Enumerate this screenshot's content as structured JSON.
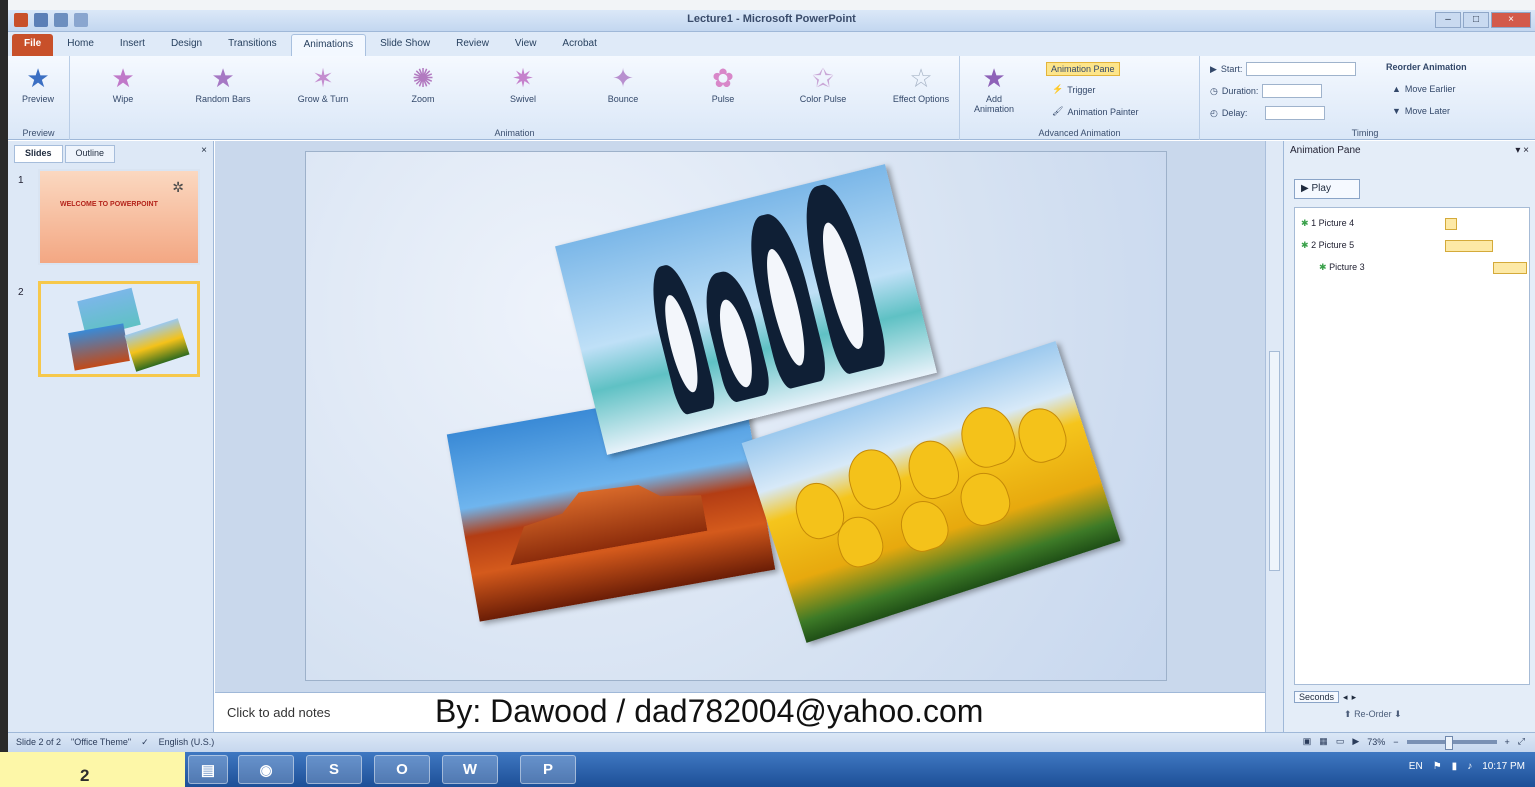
{
  "window": {
    "title": "Lecture1 - Microsoft PowerPoint"
  },
  "tabs": [
    "File",
    "Home",
    "Insert",
    "Design",
    "Transitions",
    "Animations",
    "Slide Show",
    "Review",
    "View",
    "Acrobat"
  ],
  "ribbon": {
    "preview_label": "Preview",
    "preview_group": "Preview",
    "animations": [
      "Wipe",
      "Random Bars",
      "Grow & Turn",
      "Zoom",
      "Swivel",
      "Bounce",
      "Pulse",
      "Color Pulse"
    ],
    "effect_options": "Effect Options",
    "animation_group": "Animation",
    "add_animation": "Add Animation",
    "animation_pane": "Animation Pane",
    "trigger": "Trigger",
    "animation_painter": "Animation Painter",
    "advanced_group": "Advanced Animation",
    "start": "Start:",
    "duration": "Duration:",
    "delay": "Delay:",
    "reorder_title": "Reorder Animation",
    "move_earlier": "Move Earlier",
    "move_later": "Move Later",
    "timing_group": "Timing"
  },
  "left_panel": {
    "tab_slides": "Slides",
    "tab_outline": "Outline",
    "close": "×",
    "slide1_num": "1",
    "slide1_title": "WELCOME TO POWERPOINT",
    "slide2_num": "2"
  },
  "notes": {
    "hint": "Click to add notes",
    "watermark": "By: Dawood / dad782004@yahoo.com"
  },
  "animation_pane": {
    "title": "Animation Pane",
    "close": "▾ ×",
    "play": "Play",
    "items": [
      {
        "label": "1 Picture 4"
      },
      {
        "label": "2 Picture 5"
      },
      {
        "label": "Picture 3"
      }
    ],
    "seconds": "Seconds",
    "reorder": "Re-Order"
  },
  "status": {
    "slide": "Slide 2 of 2",
    "theme": "\"Office Theme\"",
    "language": "English (U.S.)",
    "zoom": "73%"
  },
  "taskbar": {
    "apps": [
      "S",
      "W",
      "P"
    ],
    "time": "10:17 PM"
  },
  "page_number": "2",
  "colors": {
    "file_tab": "#c8502a",
    "taskbar": "#2a5ea8",
    "accent": "#f6c84b"
  }
}
